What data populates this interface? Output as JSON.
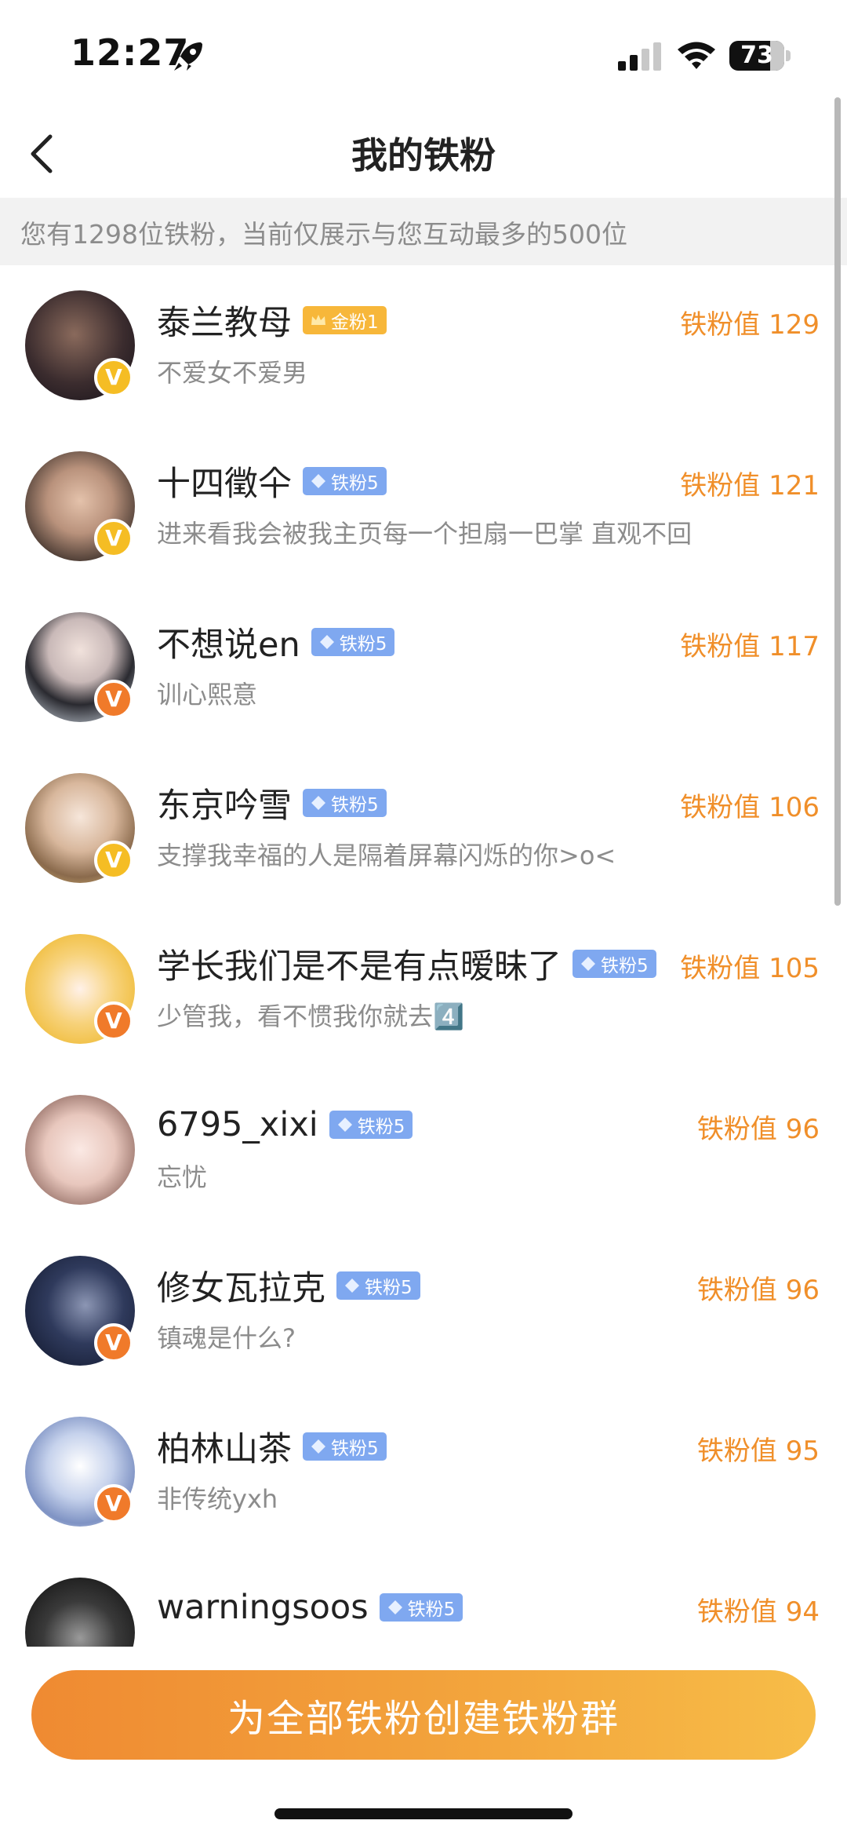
{
  "status_bar": {
    "time": "12:27",
    "battery": "73"
  },
  "nav": {
    "title": "我的铁粉"
  },
  "notice": "您有1298位铁粉，当前仅展示与您互动最多的500位",
  "fans": [
    {
      "name": "泰兰教母",
      "badge": "金粉1",
      "badge_color": "#f7b73a",
      "bio": "不爱女不爱男",
      "score": "铁粉值 129",
      "v_color": "#f5bd24"
    },
    {
      "name": "十四徵仐",
      "badge": "铁粉5",
      "badge_color": "#7fa8f0",
      "bio": "进来看我会被我主页每一个担扇一巴掌 直观不回",
      "score": "铁粉值 121",
      "v_color": "#f5bd24"
    },
    {
      "name": "不想说en",
      "badge": "铁粉5",
      "badge_color": "#7fa8f0",
      "bio": "训心熙意",
      "score": "铁粉值 117",
      "v_color": "#f07a2a"
    },
    {
      "name": "东京吟雪",
      "badge": "铁粉5",
      "badge_color": "#7fa8f0",
      "bio": "支撑我幸福的人是隔着屏幕闪烁的你>o<",
      "score": "铁粉值 106",
      "v_color": "#f5bd24"
    },
    {
      "name": "学长我们是不是有点暧昧了",
      "badge": "铁粉5",
      "badge_color": "#7fa8f0",
      "bio": "少管我，看不惯我你就去4️⃣",
      "score": "铁粉值 105",
      "v_color": "#f07a2a"
    },
    {
      "name": "6795_xixi",
      "badge": "铁粉5",
      "badge_color": "#7fa8f0",
      "bio": "忘忧",
      "score": "铁粉值 96",
      "v_color": ""
    },
    {
      "name": "修女瓦拉克",
      "badge": "铁粉5",
      "badge_color": "#7fa8f0",
      "bio": "镇魂是什么?",
      "score": "铁粉值 96",
      "v_color": "#f07a2a"
    },
    {
      "name": "柏林山茶",
      "badge": "铁粉5",
      "badge_color": "#7fa8f0",
      "bio": "非传统yxh",
      "score": "铁粉值 95",
      "v_color": "#f07a2a"
    },
    {
      "name": "warningsoos",
      "badge": "铁粉5",
      "badge_color": "#7fa8f0",
      "bio": "",
      "score": "铁粉值 94",
      "v_color": ""
    }
  ],
  "bottom": {
    "button_label": "为全部铁粉创建铁粉群"
  }
}
